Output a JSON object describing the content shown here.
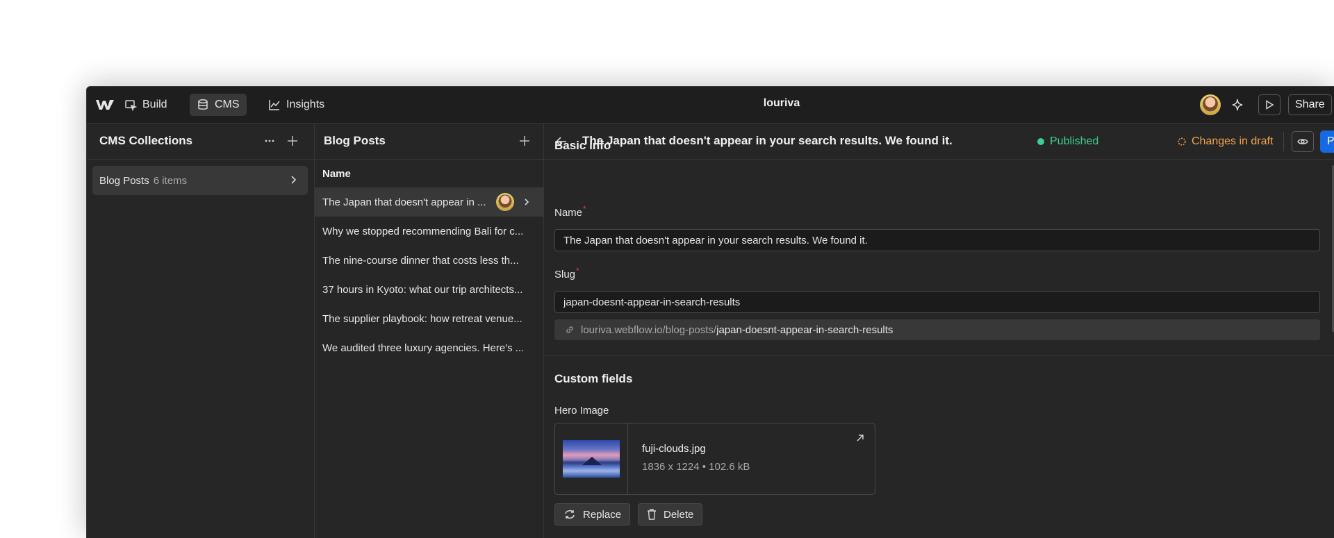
{
  "topbar": {
    "nav": [
      {
        "label": "Build",
        "icon": "build-icon"
      },
      {
        "label": "CMS",
        "icon": "database-icon"
      },
      {
        "label": "Insights",
        "icon": "chart-icon"
      }
    ],
    "site_name": "louriva",
    "share_label": "Share"
  },
  "collections": {
    "title": "CMS Collections",
    "items": [
      {
        "name": "Blog Posts",
        "count": "6 items"
      }
    ]
  },
  "posts": {
    "title": "Blog Posts",
    "column_header": "Name",
    "rows": [
      "The Japan that doesn't appear in ...",
      "Why we stopped recommending Bali for c...",
      "The nine-course dinner that costs less th...",
      "37 hours in Kyoto: what our trip architects...",
      "The supplier playbook: how retreat venue...",
      "We audited three luxury agencies. Here's ..."
    ]
  },
  "detail": {
    "title": "The Japan that doesn't appear in your search results. We found it.",
    "status_published": "Published",
    "status_draft": "Changes in draft",
    "publish_label": "Publish now",
    "basic_info_title": "Basic info",
    "name_label": "Name",
    "name_value": "The Japan that doesn't appear in your search results. We found it.",
    "slug_label": "Slug",
    "slug_value": "japan-doesnt-appear-in-search-results",
    "url_base": "louriva.webflow.io/blog-posts/",
    "url_slug": "japan-doesnt-appear-in-search-results",
    "custom_fields_title": "Custom fields",
    "hero_label": "Hero Image",
    "hero_file": "fuji-clouds.jpg",
    "hero_meta": "1836 x 1224 • 102.6 kB",
    "replace_label": "Replace",
    "delete_label": "Delete"
  },
  "colors": {
    "accent": "#1668e3",
    "published": "#3ecf8e",
    "draft": "#f5a34b",
    "required": "#e8384f"
  }
}
